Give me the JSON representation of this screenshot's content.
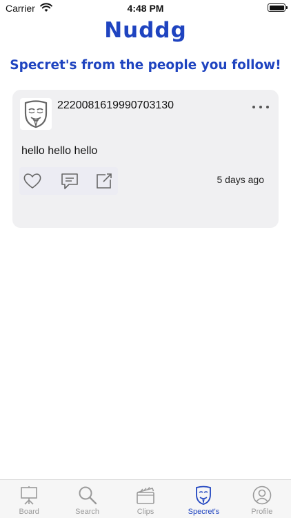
{
  "status_bar": {
    "carrier": "Carrier",
    "time": "4:48 PM",
    "wifi_icon": "wifi-icon",
    "battery_icon": "battery-icon"
  },
  "header": {
    "title": "Nuddg",
    "subtitle": "Specret's from the people you follow!"
  },
  "post": {
    "username": "2220081619990703130",
    "text": "hello hello hello",
    "time_ago": "5 days ago",
    "avatar_icon": "mask-icon",
    "actions": [
      "heart-icon",
      "comment-icon",
      "share-icon"
    ]
  },
  "tabs": [
    {
      "label": "Board",
      "icon": "board-icon",
      "active": false
    },
    {
      "label": "Search",
      "icon": "search-icon",
      "active": false
    },
    {
      "label": "Clips",
      "icon": "clapper-icon",
      "active": false
    },
    {
      "label": "Specret's",
      "icon": "mask-icon",
      "active": true
    },
    {
      "label": "Profile",
      "icon": "profile-icon",
      "active": false
    }
  ],
  "colors": {
    "accent": "#1f44c0",
    "card_bg": "#f0f0f2",
    "inactive_tab": "#9a9a9a"
  }
}
